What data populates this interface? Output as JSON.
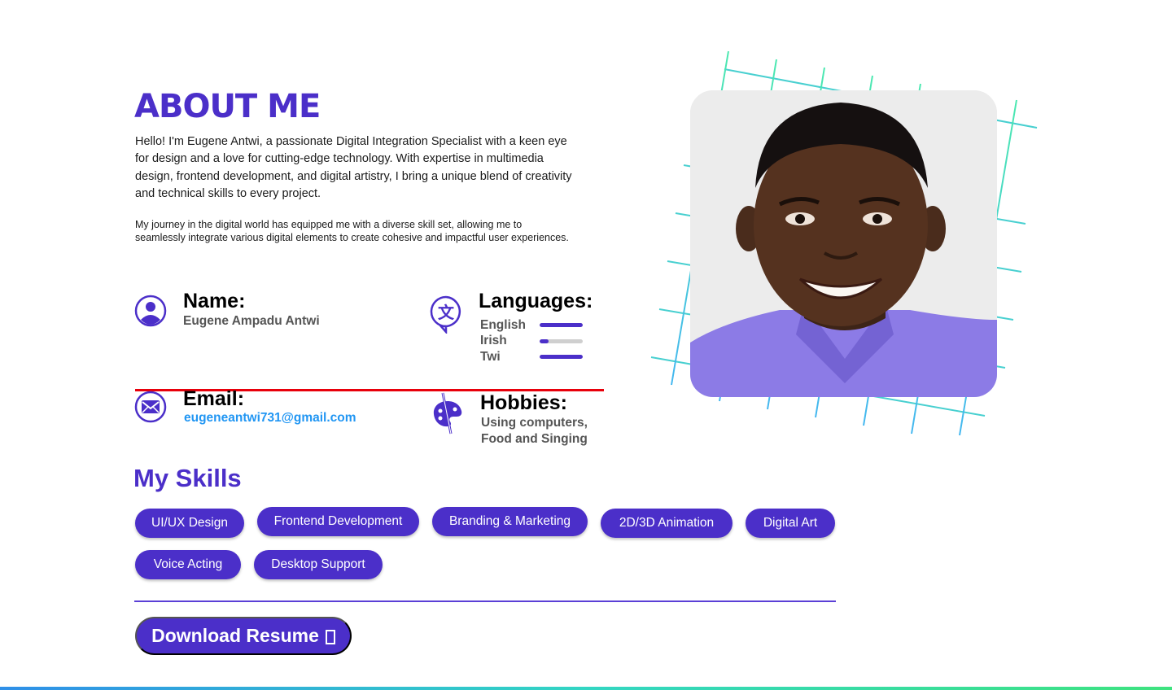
{
  "about": {
    "title": "ABOUT ME",
    "intro": "Hello! I'm Eugene Antwi, a passionate Digital Integration Specialist with a keen eye for design and a love for cutting-edge technology. With expertise in multimedia design, frontend development, and digital artistry, I bring a unique blend of creativity and technical skills to every project.",
    "intro2": "My journey in the digital world has equipped me with a diverse skill set, allowing me to seamlessly integrate various digital elements to create cohesive and impactful user experiences."
  },
  "info": {
    "name_label": "Name:",
    "name_value": "Eugene Ampadu Antwi",
    "languages_label": "Languages:",
    "languages": [
      {
        "name": "English",
        "level": 1.0
      },
      {
        "name": "Irish",
        "level": 0.2
      },
      {
        "name": "Twi",
        "level": 1.0
      }
    ],
    "email_label": "Email:",
    "email_value": "eugeneantwi731@gmail.com",
    "hobbies_label": "Hobbies:",
    "hobbies_value": "Using computers, Food and Singing"
  },
  "skills": {
    "title": "My Skills",
    "items": [
      "UI/UX Design",
      "Frontend Development",
      "Branding & Marketing",
      "2D/3D Animation",
      "Digital Art",
      "Voice Acting",
      "Desktop Support"
    ]
  },
  "download": {
    "label": "Download Resume",
    "icon": "download-icon"
  },
  "colors": {
    "accent": "#4b2fc9",
    "email_link": "#2196f3",
    "divider_red": "#e8000b",
    "photo_shirt": "#8c7be6"
  }
}
